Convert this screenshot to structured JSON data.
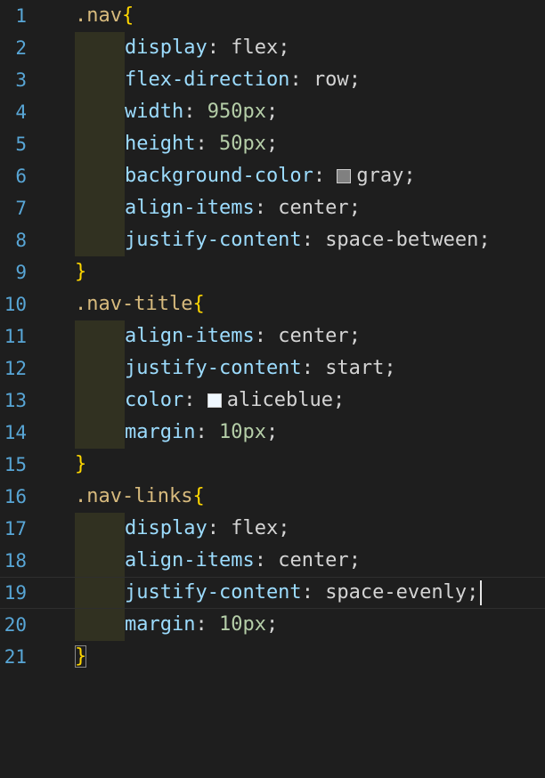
{
  "colors": {
    "background": "#1e1e1e",
    "line_number": "#58a6d6",
    "selector": "#d7ba7d",
    "brace": "#ffd700",
    "property": "#9cdcfe",
    "number": "#b5cea8",
    "text": "#d4d4d4"
  },
  "lines": [
    {
      "num": "1",
      "selector": ".nav",
      "brace": "{"
    },
    {
      "num": "2",
      "prop": "display",
      "value": "flex"
    },
    {
      "num": "3",
      "prop": "flex-direction",
      "value": "row"
    },
    {
      "num": "4",
      "prop": "width",
      "value": "950px"
    },
    {
      "num": "5",
      "prop": "height",
      "value": "50px"
    },
    {
      "num": "6",
      "prop": "background-color",
      "value": "gray",
      "swatch": "#808080"
    },
    {
      "num": "7",
      "prop": "align-items",
      "value": "center"
    },
    {
      "num": "8",
      "prop": "justify-content",
      "value": "space-between"
    },
    {
      "num": "9",
      "brace": "}"
    },
    {
      "num": "10",
      "selector": ".nav-title",
      "brace": "{"
    },
    {
      "num": "11",
      "prop": "align-items",
      "value": "center"
    },
    {
      "num": "12",
      "prop": "justify-content",
      "value": "start"
    },
    {
      "num": "13",
      "prop": "color",
      "value": "aliceblue",
      "swatch": "#f0f8ff"
    },
    {
      "num": "14",
      "prop": "margin",
      "value": "10px"
    },
    {
      "num": "15",
      "brace": "}"
    },
    {
      "num": "16",
      "selector": ".nav-links",
      "brace": "{"
    },
    {
      "num": "17",
      "prop": "display",
      "value": "flex"
    },
    {
      "num": "18",
      "prop": "align-items",
      "value": "center"
    },
    {
      "num": "19",
      "prop": "justify-content",
      "value": "space-evenly",
      "cursor": true
    },
    {
      "num": "20",
      "prop": "margin",
      "value": "10px"
    },
    {
      "num": "21",
      "brace": "}",
      "matched": true
    }
  ]
}
